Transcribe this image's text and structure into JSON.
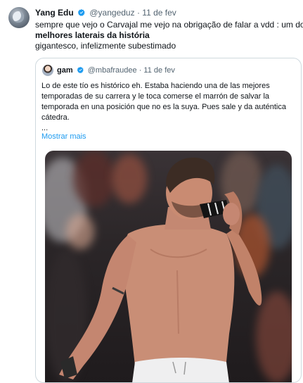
{
  "tweet": {
    "author_name": "Yang Edu",
    "handle": "@yangeduz",
    "separator": "·",
    "date": "11 de fev",
    "text_line1": "sempre que vejo o Carvajal me vejo na obrigação de falar a vdd : um dos",
    "text_line2_bold": "melhores laterais da história",
    "text_line3": "gigantesco, infelizmente subestimado"
  },
  "quoted_tweet": {
    "author_name": "gam",
    "handle": "@mbafraudee",
    "separator": "·",
    "date": "11 de fev",
    "text_lines": [
      "Lo de este tío es histórico eh. Estaba haciendo una de las mejores",
      "temporadas de su carrera y le toca comerse el marrón de salvar la",
      "temporada en una posición que no es la suya. Pues sale y da auténtica",
      "cátedra.",
      "..."
    ],
    "show_more": "Mostrar mais"
  },
  "icons": {
    "verified": "verified-badge-icon"
  },
  "colors": {
    "link": "#1d9bf0",
    "muted": "#536471",
    "border": "#cfd9de"
  }
}
